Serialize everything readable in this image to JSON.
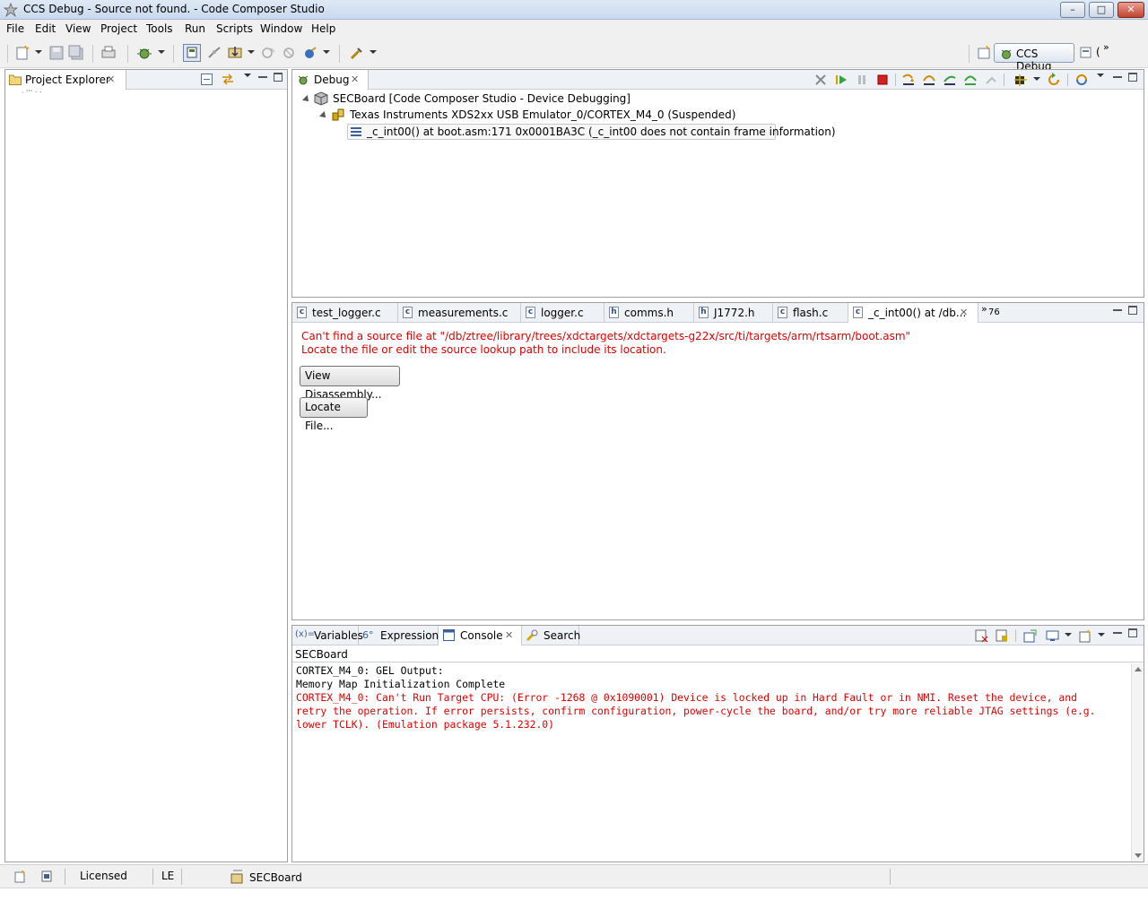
{
  "window": {
    "title": "CCS Debug - Source not found. - Code Composer Studio",
    "buttons": [
      "–",
      "□",
      "✕"
    ]
  },
  "menu": {
    "items": [
      {
        "label": "File"
      },
      {
        "label": "Edit"
      },
      {
        "label": "View"
      },
      {
        "label": "Project"
      },
      {
        "label": "Tools"
      },
      {
        "label": "Run"
      },
      {
        "label": "Scripts"
      },
      {
        "label": "Window"
      },
      {
        "label": "Help"
      }
    ]
  },
  "perspective": {
    "label": "CCS Debug"
  },
  "project_explorer": {
    "tab_label": "Project Explorer",
    "tree_stub": "· ʿʿʿ ˑ ˑ"
  },
  "debug_view": {
    "tab_label": "Debug",
    "tree": {
      "root": "SECBoard [Code Composer Studio - Device Debugging]",
      "child": "Texas Instruments XDS2xx USB Emulator_0/CORTEX_M4_0 (Suspended)",
      "frame": "_c_int00() at boot.asm:171 0x0001BA3C  (_c_int00 does not contain frame information)"
    }
  },
  "editor": {
    "tabs": [
      {
        "label": "test_logger.c",
        "icon": "c-file-icon"
      },
      {
        "label": "measurements.c",
        "icon": "c-file-icon"
      },
      {
        "label": "logger.c",
        "icon": "c-file-icon"
      },
      {
        "label": "comms.h",
        "icon": "h-file-icon"
      },
      {
        "label": "J1772.h",
        "icon": "h-file-icon"
      },
      {
        "label": "flash.c",
        "icon": "c-file-icon"
      },
      {
        "label": "_c_int00() at /db...",
        "icon": "c-file-icon"
      }
    ],
    "overflow_count": "76",
    "message_line1": "Can't find a source file at \"/db/ztree/library/trees/xdctargets/xdctargets-g22x/src/ti/targets/arm/rtsarm/boot.asm\"",
    "message_line2": "Locate the file or edit the source lookup path to include its location.",
    "view_disassembly_label": "View Disassembly...",
    "locate_file_label": "Locate File..."
  },
  "bottom_panel": {
    "tabs": [
      {
        "label": "Variables"
      },
      {
        "label": "Expressions"
      },
      {
        "label": "Console"
      },
      {
        "label": "Search"
      }
    ],
    "console_title": "SECBoard",
    "lines": {
      "l1": "CORTEX_M4_0: GEL Output:",
      "l2": "Memory Map Initialization Complete",
      "l3": "CORTEX_M4_0: Can't Run Target CPU: (Error -1268 @ 0x1090001) Device is locked up in Hard Fault or in NMI. Reset the device, and",
      "l4": "retry the operation. If error persists, confirm configuration, power-cycle the board, and/or try more reliable JTAG settings (e.g.",
      "l5": "lower TCLK). (Emulation package 5.1.232.0)"
    }
  },
  "status_bar": {
    "license": "Licensed",
    "endian": "LE",
    "target": "SECBoard"
  },
  "colors": {
    "error_red": "#e00000",
    "panel_header": "#eef1f6"
  }
}
